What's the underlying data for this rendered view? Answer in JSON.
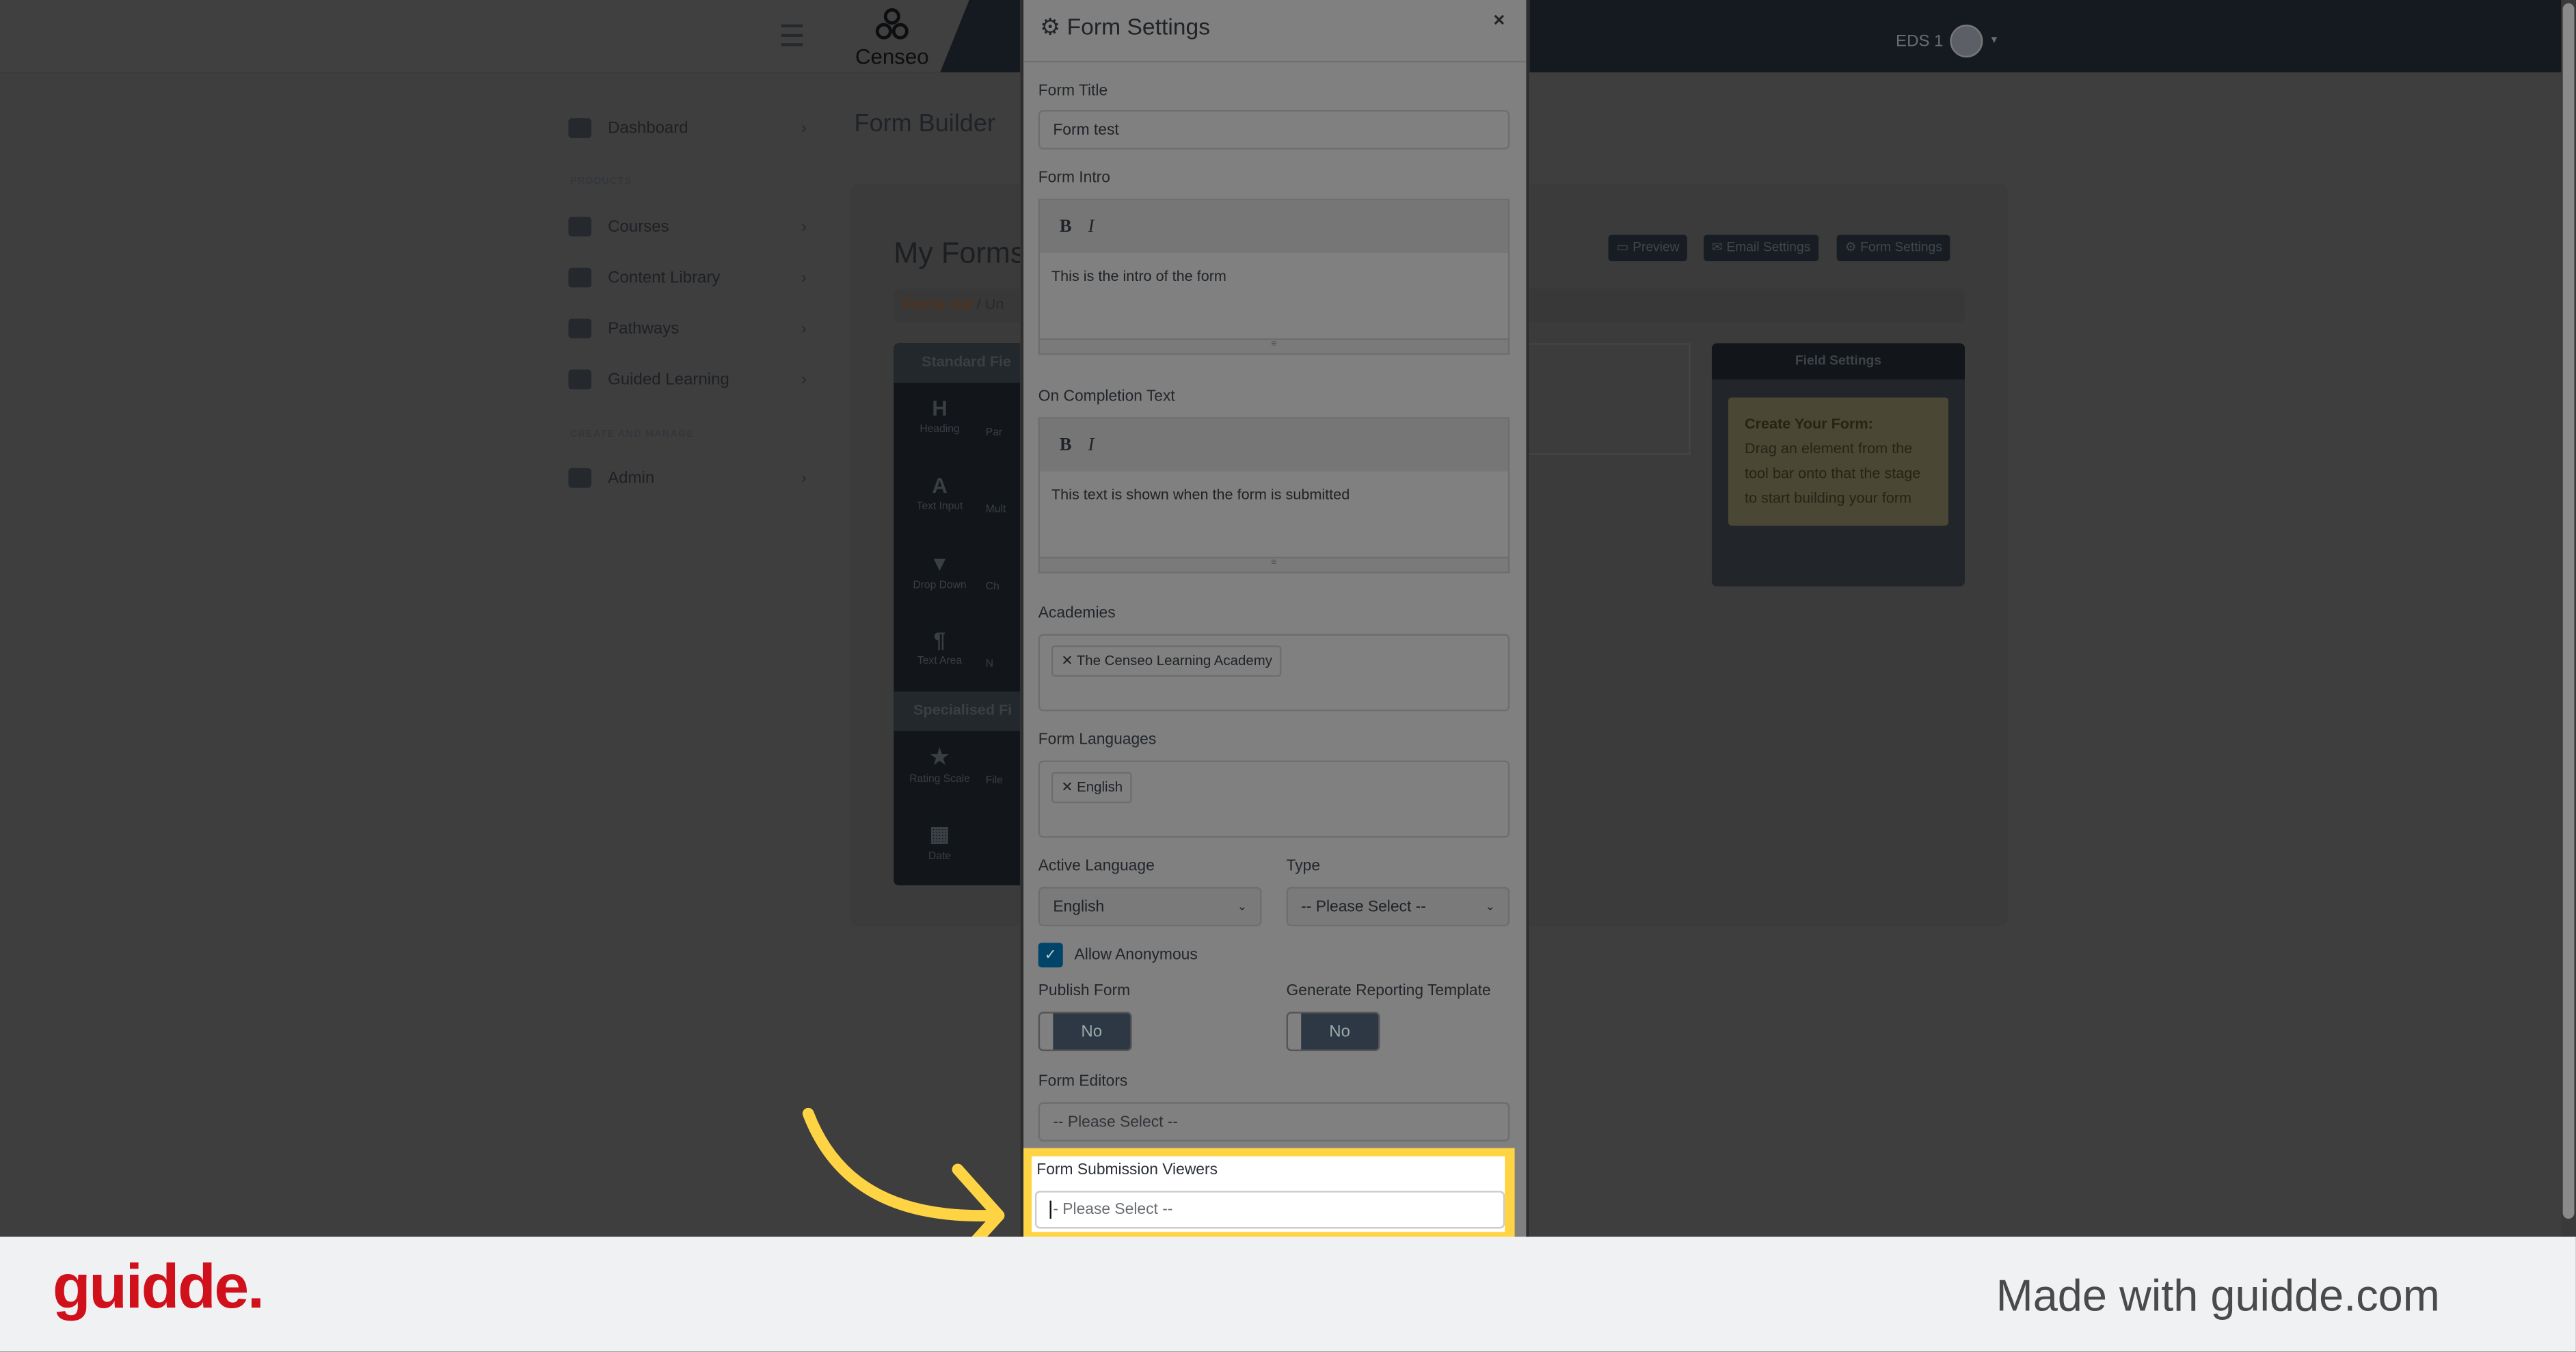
{
  "header": {
    "menu_icon": "hamburger-icon",
    "logo_text": "Censeo",
    "user_label": "EDS 1"
  },
  "sidebar": {
    "items": [
      {
        "label": "Dashboard",
        "icon": "dashboard-icon"
      },
      {
        "label": "Courses",
        "icon": "courses-icon"
      },
      {
        "label": "Content Library",
        "icon": "book-icon"
      },
      {
        "label": "Pathways",
        "icon": "award-icon"
      },
      {
        "label": "Guided Learning",
        "icon": "clipboard-icon"
      },
      {
        "label": "Admin",
        "icon": "gear-icon"
      }
    ],
    "section_products": "PRODUCTS",
    "section_create": "CREATE AND MANAGE"
  },
  "main": {
    "page_title": "Form Builder",
    "heading": "My Forms",
    "breadcrumb": {
      "link": "Forms List",
      "sep": "/",
      "current": "Un"
    },
    "buttons": {
      "preview": "Preview",
      "email": "Email Settings",
      "form_settings": "Form Settings"
    },
    "toolbox": {
      "standard_header": "Standard Fie",
      "standard": [
        {
          "glyph": "H",
          "label": "Heading"
        },
        {
          "glyph": "A",
          "label": "Text Input"
        },
        {
          "glyph": "▾",
          "label": "Drop Down"
        },
        {
          "glyph": "¶",
          "label": "Text Area"
        }
      ],
      "standard_col2": [
        "Par",
        "Mult",
        "Ch",
        "N"
      ],
      "specialised_header": "Specialised Fi",
      "specialised": [
        {
          "glyph": "★",
          "label": "Rating Scale"
        },
        {
          "glyph": "▦",
          "label": "Date"
        }
      ],
      "specialised_col2": [
        "File"
      ]
    },
    "field_settings": {
      "title": "Field Settings",
      "note_title": "Create Your Form:",
      "note_body": "Drag an element from the tool bar onto that the stage to start building your form"
    }
  },
  "modal": {
    "title": "Form Settings",
    "close": "×",
    "form_title_label": "Form Title",
    "form_title_value": "Form test",
    "intro_label": "Form Intro",
    "intro_text": "This is the intro of the form",
    "completion_label": "On Completion Text",
    "completion_text": "This text is shown when the form is submitted",
    "bold": "B",
    "italic": "I",
    "academies_label": "Academies",
    "academies": [
      "The Censeo Learning Academy"
    ],
    "languages_label": "Form Languages",
    "languages": [
      "English"
    ],
    "active_language_label": "Active Language",
    "active_language_value": "English",
    "type_label": "Type",
    "type_value": "-- Please Select --",
    "allow_anonymous_label": "Allow Anonymous",
    "allow_anonymous_checked": true,
    "publish_label": "Publish Form",
    "publish_value": "No",
    "reporting_label": "Generate Reporting Template",
    "reporting_value": "No",
    "editors_label": "Form Editors",
    "editors_placeholder": "-- Please Select --",
    "viewers_label": "Form Submission Viewers",
    "viewers_placeholder": "- Please Select --"
  },
  "highlight_color": "#ffd444",
  "footer": {
    "brand": "guidde.",
    "made_with": "Made with guidde.com"
  }
}
